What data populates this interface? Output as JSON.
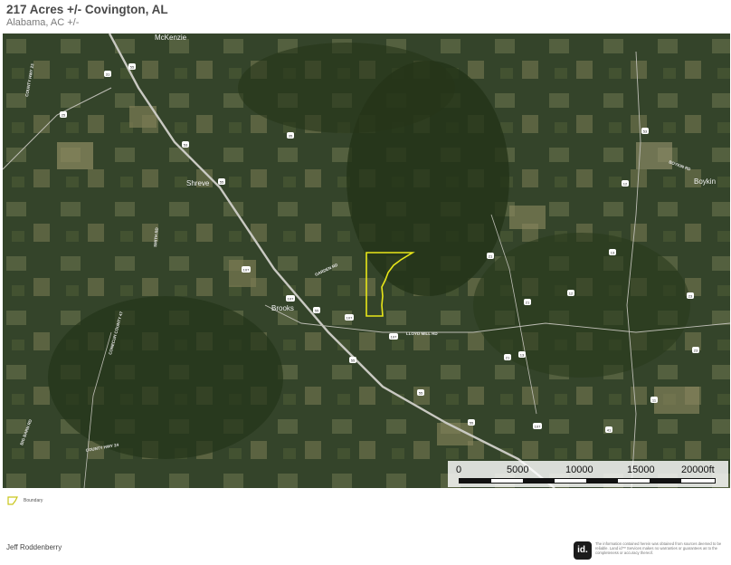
{
  "header": {
    "title": "217 Acres +/- Covington, AL",
    "subtitle": "Alabama,  AC +/-"
  },
  "map": {
    "places": [
      "McKenzie",
      "Shreve",
      "Brooks",
      "Boykin"
    ],
    "road_labels": [
      "COUNTY HWY 23",
      "GARDEN RD",
      "SMITH RD",
      "LLOYD MILL RD",
      "BOYKIN RD",
      "CONECUH COUNTY 47",
      "COUNTY HWY 24",
      "BIG BARN RD"
    ],
    "shields": [
      "55",
      "31",
      "25",
      "53",
      "35",
      "55",
      "107",
      "107",
      "55",
      "21",
      "53",
      "12",
      "21",
      "107",
      "107",
      "13",
      "55",
      "55",
      "55",
      "11",
      "107",
      "41",
      "23",
      "12",
      "13",
      "21",
      "23"
    ],
    "boundary_color": "#e8e619"
  },
  "scale": {
    "labels": [
      "0",
      "5000",
      "10000",
      "15000",
      "20000ft"
    ]
  },
  "legend": {
    "label": "Boundary",
    "icon": "boundary-outline-icon"
  },
  "footer": {
    "agent": "Jeff Roddenberry",
    "logo_text": "id.",
    "disclaimer": "The information contained herein was obtained from sources deemed to be reliable. Land id™ Services makes no warranties or guarantees as to the completeness or accuracy thereof."
  }
}
